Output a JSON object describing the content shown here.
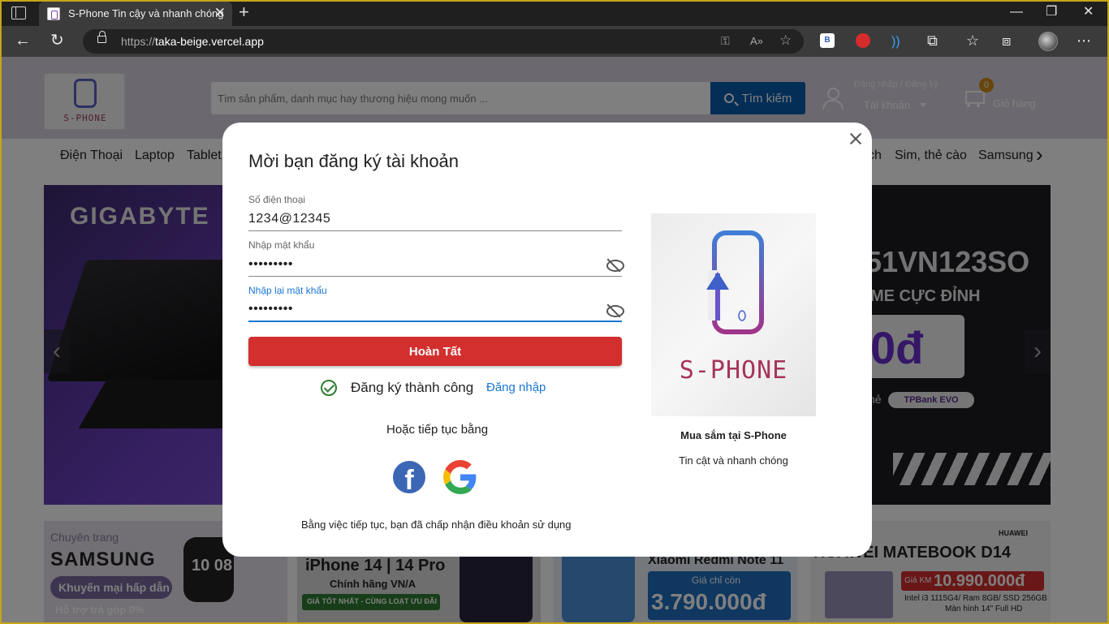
{
  "browser": {
    "tab_title": "S-Phone Tin cậy và nhanh chóng",
    "url_prefix": "https://",
    "url_host": "taka-beige.vercel.app"
  },
  "header": {
    "logo_text": "S-PHONE",
    "search_placeholder": "Tìm sản phẩm, danh mục hay thương hiệu mong muốn ...",
    "search_button": "Tìm kiếm",
    "account_top": "Đăng nhập / Đăng ký",
    "account_label": "Tài khoản",
    "cart_count": "0",
    "cart_label": "Giỏ hàng"
  },
  "categories": [
    "Điện Thoại",
    "Laptop",
    "Tablet",
    "ch",
    "Sim, thẻ cào",
    "Samsung"
  ],
  "banner": {
    "brand": "GIGABYTE",
    "model": "51VN123SO",
    "line2": "ME CỰC ĐỈNH",
    "price": "0đ",
    "note": "hẻ",
    "bank": "TPBank EVO"
  },
  "promos": {
    "p1_top": "Chuyên trang",
    "p1_brand": "SAMSUNG",
    "p1_pill": "Khuyến mại hấp dẫn",
    "p1_bottom": "Hỗ trợ trả góp 0%",
    "p1_watch": "10 08",
    "p2_title": "iPhone 14 | 14 Pro",
    "p2_sub": "Chính hãng VN/A",
    "p2_pill": "GIÁ TỐT NHẤT - CÙNG LOẠT ƯU ĐÃI",
    "p3_title": "Xiaomi Redmi Note 11",
    "p3_sub": "Giá chỉ còn",
    "p3_price": "3.790.000đ",
    "p4_brand": "HUAWEI",
    "p4_title": "HUAWEI MATEBOOK D14",
    "p4_tag": "Giá KM",
    "p4_price": "10.990.000đ",
    "p4_spec1": "Intel i3 1115G4/ Ram 8GB/ SSD 256GB",
    "p4_spec2": "Màn hình 14\" Full HD"
  },
  "modal": {
    "title": "Mời bạn đăng ký tài khoản",
    "phone_label": "Số điện thoại",
    "phone_value": "1234@12345",
    "password_label": "Nhập mật khẩu",
    "password_value": "123456789",
    "confirm_label": "Nhập lại mật khẩu",
    "confirm_value": "123456789",
    "submit": "Hoàn Tất",
    "success": "Đăng ký thành công",
    "login_link": "Đăng nhập",
    "or_continue": "Hoặc tiếp tục bằng",
    "terms": "Bằng việc tiếp tục, bạn đã chấp nhận điều khoản sử dụng",
    "side_logo_text": "S-PHONE",
    "side_title": "Mua sắm tại S-Phone",
    "side_subtitle": "Tin cật và nhanh chóng"
  }
}
